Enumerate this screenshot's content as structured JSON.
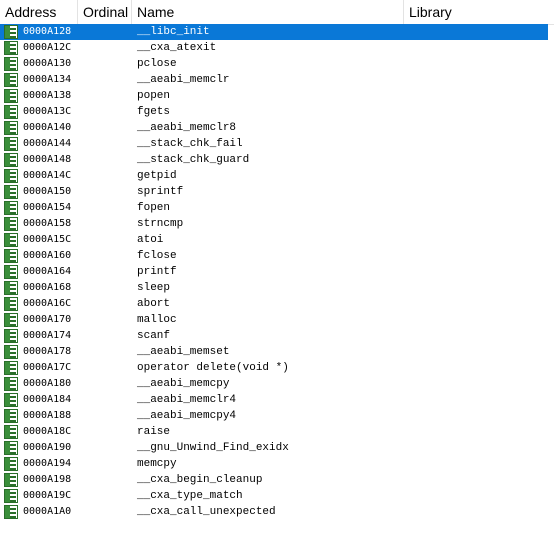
{
  "columns": [
    "Address",
    "Ordinal",
    "Name",
    "Library"
  ],
  "icon": "import-function-icon",
  "selected_index": 0,
  "rows": [
    {
      "address": "0000A128",
      "ordinal": "",
      "name": "__libc_init",
      "library": ""
    },
    {
      "address": "0000A12C",
      "ordinal": "",
      "name": "__cxa_atexit",
      "library": ""
    },
    {
      "address": "0000A130",
      "ordinal": "",
      "name": "pclose",
      "library": ""
    },
    {
      "address": "0000A134",
      "ordinal": "",
      "name": "__aeabi_memclr",
      "library": ""
    },
    {
      "address": "0000A138",
      "ordinal": "",
      "name": "popen",
      "library": ""
    },
    {
      "address": "0000A13C",
      "ordinal": "",
      "name": "fgets",
      "library": ""
    },
    {
      "address": "0000A140",
      "ordinal": "",
      "name": "__aeabi_memclr8",
      "library": ""
    },
    {
      "address": "0000A144",
      "ordinal": "",
      "name": "__stack_chk_fail",
      "library": ""
    },
    {
      "address": "0000A148",
      "ordinal": "",
      "name": "__stack_chk_guard",
      "library": ""
    },
    {
      "address": "0000A14C",
      "ordinal": "",
      "name": "getpid",
      "library": ""
    },
    {
      "address": "0000A150",
      "ordinal": "",
      "name": "sprintf",
      "library": ""
    },
    {
      "address": "0000A154",
      "ordinal": "",
      "name": "fopen",
      "library": ""
    },
    {
      "address": "0000A158",
      "ordinal": "",
      "name": "strncmp",
      "library": ""
    },
    {
      "address": "0000A15C",
      "ordinal": "",
      "name": "atoi",
      "library": ""
    },
    {
      "address": "0000A160",
      "ordinal": "",
      "name": "fclose",
      "library": ""
    },
    {
      "address": "0000A164",
      "ordinal": "",
      "name": "printf",
      "library": ""
    },
    {
      "address": "0000A168",
      "ordinal": "",
      "name": "sleep",
      "library": ""
    },
    {
      "address": "0000A16C",
      "ordinal": "",
      "name": "abort",
      "library": ""
    },
    {
      "address": "0000A170",
      "ordinal": "",
      "name": "malloc",
      "library": ""
    },
    {
      "address": "0000A174",
      "ordinal": "",
      "name": "scanf",
      "library": ""
    },
    {
      "address": "0000A178",
      "ordinal": "",
      "name": "__aeabi_memset",
      "library": ""
    },
    {
      "address": "0000A17C",
      "ordinal": "",
      "name": "operator delete(void *)",
      "library": ""
    },
    {
      "address": "0000A180",
      "ordinal": "",
      "name": "__aeabi_memcpy",
      "library": ""
    },
    {
      "address": "0000A184",
      "ordinal": "",
      "name": "__aeabi_memclr4",
      "library": ""
    },
    {
      "address": "0000A188",
      "ordinal": "",
      "name": "__aeabi_memcpy4",
      "library": ""
    },
    {
      "address": "0000A18C",
      "ordinal": "",
      "name": "raise",
      "library": ""
    },
    {
      "address": "0000A190",
      "ordinal": "",
      "name": "__gnu_Unwind_Find_exidx",
      "library": ""
    },
    {
      "address": "0000A194",
      "ordinal": "",
      "name": "memcpy",
      "library": ""
    },
    {
      "address": "0000A198",
      "ordinal": "",
      "name": "__cxa_begin_cleanup",
      "library": ""
    },
    {
      "address": "0000A19C",
      "ordinal": "",
      "name": "__cxa_type_match",
      "library": ""
    },
    {
      "address": "0000A1A0",
      "ordinal": "",
      "name": "__cxa_call_unexpected",
      "library": ""
    }
  ]
}
